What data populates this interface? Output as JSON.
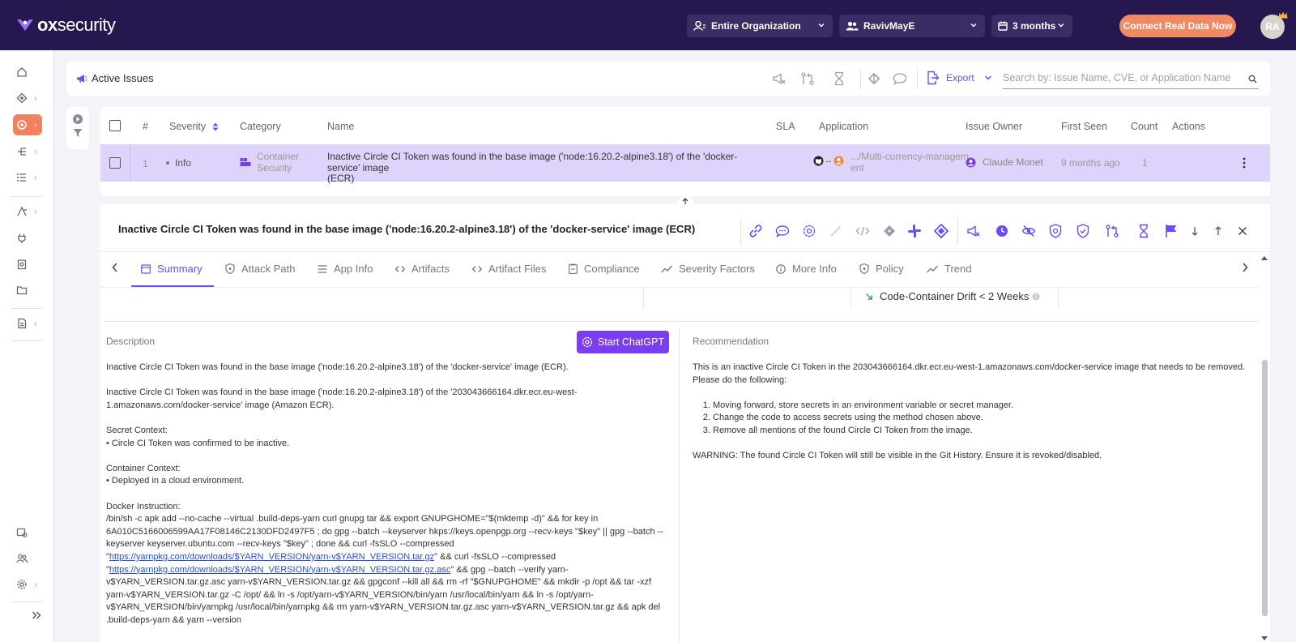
{
  "topbar": {
    "brand_ox": "ox",
    "brand_security": "security",
    "scope_label": "Entire Organization",
    "user_label": "RavivMayE",
    "period_label": "3 months",
    "connect_label": "Connect Real Data Now",
    "avatar_initials": "RA"
  },
  "header": {
    "title": "Active Issues",
    "export_label": "Export",
    "search_placeholder": "Search by: Issue Name, CVE, or Application Name"
  },
  "table": {
    "columns": [
      "#",
      "Severity",
      "Category",
      "Name",
      "SLA",
      "Application",
      "Issue Owner",
      "First Seen",
      "Count",
      "Actions"
    ],
    "row": {
      "index": "1",
      "severity": "Info",
      "category_line1": "Container",
      "category_line2": "Security",
      "name_line1": "Inactive Circle CI Token was found in the base image ('node:16.20.2-alpine3.18') of the 'docker-service' image",
      "name_line2": "(ECR)",
      "application_line1": ".../Multi-currency-managem",
      "application_line2": "ent",
      "owner": "Claude Monet",
      "first_seen": "9 months ago",
      "count": "1"
    }
  },
  "detail": {
    "title": "Inactive Circle CI Token was found in the base image ('node:16.20.2-alpine3.18') of the 'docker-service' image (ECR)",
    "tabs": [
      "Summary",
      "Attack Path",
      "App Info",
      "Artifacts",
      "Artifact Files",
      "Compliance",
      "Severity Factors",
      "More Info",
      "Policy",
      "Trend"
    ],
    "drift_label": "Code-Container Drift < 2 Weeks",
    "description_label": "Description",
    "recommendation_label": "Recommendation",
    "chatgpt_label": "Start ChatGPT",
    "description": {
      "p1": "Inactive Circle CI Token was found in the base image ('node:16.20.2-alpine3.18') of the 'docker-service' image (ECR).",
      "p2": "Inactive Circle CI Token was found in the base image ('node:16.20.2-alpine3.18') of the '203043666164.dkr.ecr.eu-west-1.amazonaws.com/docker-service' image (Amazon ECR).",
      "secret_title": "Secret Context:",
      "secret_item": "• Circle CI Token was confirmed to be inactive.",
      "container_title": "Container Context:",
      "container_item": "• Deployed in a cloud environment.",
      "docker_title": "Docker Instruction:",
      "docker_part1": "/bin/sh -c apk add --no-cache --virtual .build-deps-yarn curl gnupg tar && export GNUPGHOME=\"$(mktemp -d)\" && for key in 6A010C5166006599AA17F08146C2130DFD2497F5 ; do gpg --batch --keyserver hkps://keys.openpgp.org --recv-keys \"$key\" || gpg --batch --keyserver keyserver.ubuntu.com --recv-keys \"$key\" ; done && curl -fsSLO --compressed \"",
      "docker_link1": "https://yarnpkg.com/downloads/$YARN_VERSION/yarn-v$YARN_VERSION.tar.gz",
      "docker_part2": "\" && curl -fsSLO --compressed \"",
      "docker_link2": "https://yarnpkg.com/downloads/$YARN_VERSION/yarn-v$YARN_VERSION.tar.gz.asc",
      "docker_part3": "\" && gpg --batch --verify yarn-v$YARN_VERSION.tar.gz.asc yarn-v$YARN_VERSION.tar.gz && gpgconf --kill all && rm -rf \"$GNUPGHOME\" && mkdir -p /opt && tar -xzf yarn-v$YARN_VERSION.tar.gz -C /opt/ && ln -s /opt/yarn-v$YARN_VERSION/bin/yarn /usr/local/bin/yarn && ln -s /opt/yarn-v$YARN_VERSION/bin/yarnpkg /usr/local/bin/yarnpkg && rm yarn-v$YARN_VERSION.tar.gz.asc yarn-v$YARN_VERSION.tar.gz && apk del .build-deps-yarn && yarn --version"
    },
    "recommendation": {
      "intro": "This is an inactive Circle CI Token in the 203043666164.dkr.ecr.eu-west-1.amazonaws.com/docker-service image that needs to be removed. Please do the following:",
      "steps": [
        "Moving forward, store secrets in an environment variable or secret manager.",
        "Change the code to access secrets using the method chosen above.",
        "Remove all mentions of the found Circle CI Token from the image."
      ],
      "warning": "WARNING: The found Circle CI Token will still be visible in the Git History. Ensure it is revoked/disabled."
    }
  },
  "colors": {
    "topbar": "#26184f",
    "accent": "#6c4df5",
    "connect": "#f08a65",
    "row_selected": "#ded3fb",
    "chatgpt": "#7a3ef0"
  }
}
